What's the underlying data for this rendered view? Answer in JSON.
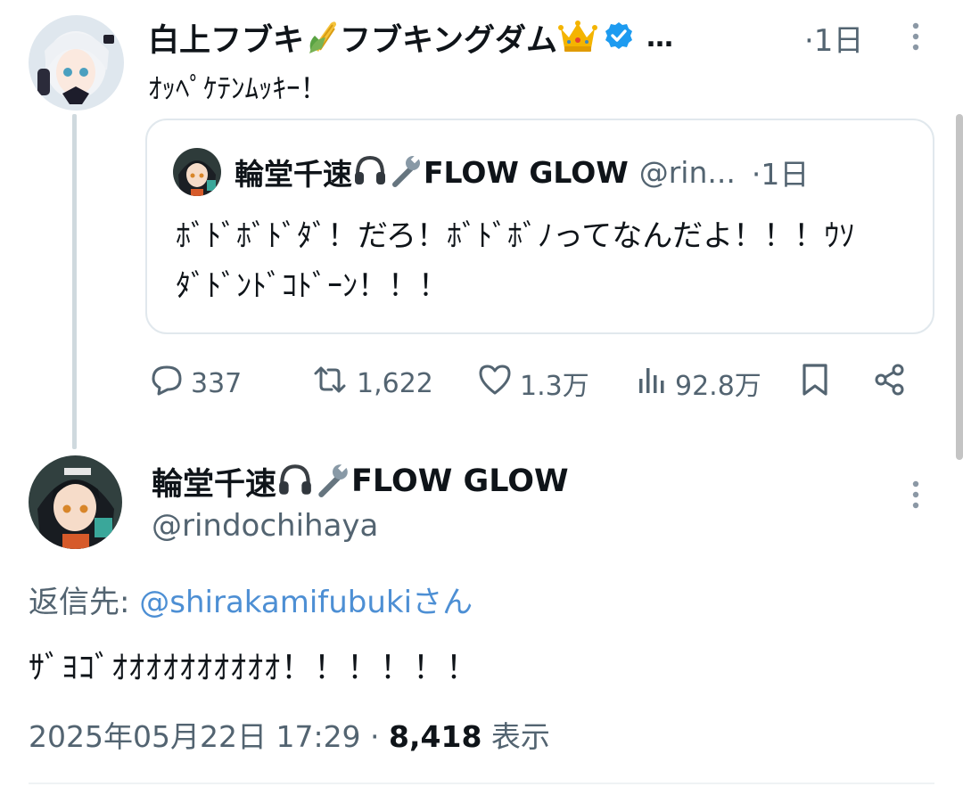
{
  "post1": {
    "display_name": "白上フブキ",
    "display_name_suffix": "フブキングダム",
    "emojis": [
      "corn-emoji",
      "crown-emoji"
    ],
    "ellipsis": "…",
    "time": "·1日",
    "text": "ｵｯﾍﾟｹﾃﾝﾑｯｷｰ！",
    "quote": {
      "name": "輪堂千速",
      "name_suffix": "FLOW GLOW",
      "emojis": [
        "headphone-emoji",
        "wrench-emoji"
      ],
      "handle": "@rin...",
      "time": "·1日",
      "text": "ﾎﾞﾄﾞﾎﾞﾄﾞﾀﾞ！だろ！ﾎﾞﾄﾞﾎﾞﾉってなんだよ！！！ｳｿﾀﾞﾄﾞﾝﾄﾞｺﾄﾞｰﾝ！！！"
    },
    "actions": {
      "replies": "337",
      "reposts": "1,622",
      "likes": "1.3万",
      "views": "92.8万"
    }
  },
  "post2": {
    "name": "輪堂千速",
    "name_suffix": "FLOW GLOW",
    "emojis": [
      "headphone-emoji",
      "wrench-emoji"
    ],
    "handle": "@rindochihaya",
    "reply_label": "返信先: ",
    "reply_target": "@shirakamifubukiさん",
    "text": "ｻﾞﾖｺﾞｵｵｵｵｵｵｵｵｵｵ！！！！！！",
    "timestamp": "2025年05月22日 17:29 · ",
    "view_count": "8,418",
    "view_label": " 表示"
  },
  "colors": {
    "text": "#0f1419",
    "muted": "#536471",
    "link": "#4d8fd4",
    "verified": "#1d9bf0",
    "border": "#e1e8ed"
  }
}
